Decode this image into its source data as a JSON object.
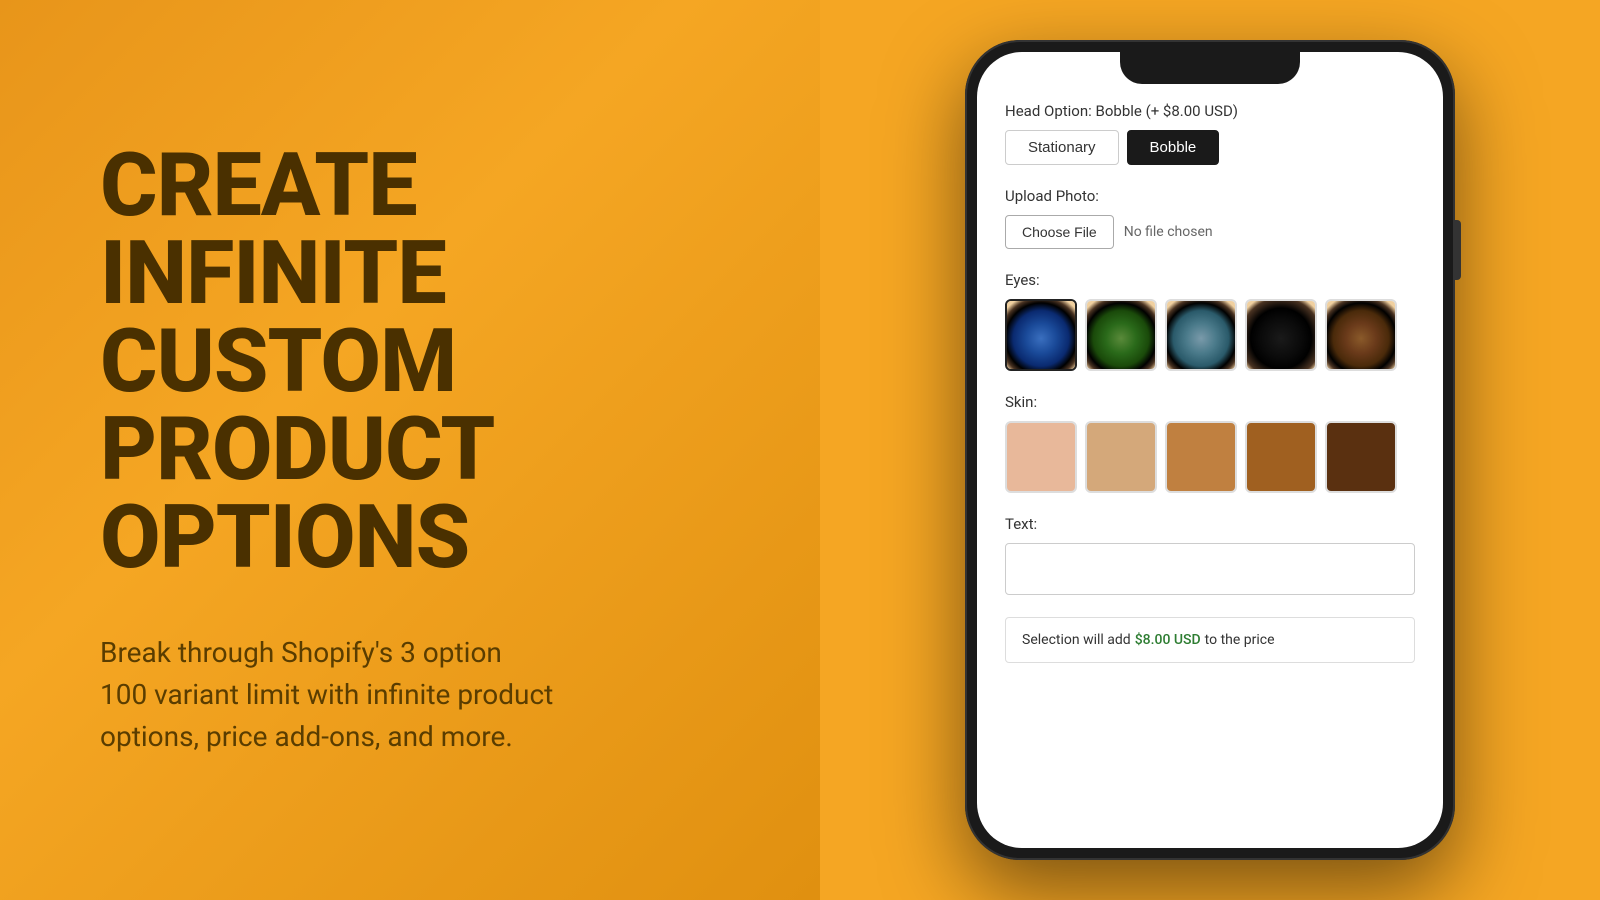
{
  "left": {
    "headline_line1": "CREATE",
    "headline_line2": "INFINITE CUSTOM",
    "headline_line3": "PRODUCT OPTIONS",
    "subtext": "Break through Shopify's 3 option\n100 variant limit with infinite product\noptions, price add-ons, and more."
  },
  "phone": {
    "head_option": {
      "label_key": "Head Option:",
      "label_value": "Bobble  (+ $8.00 USD)",
      "btn_stationary": "Stationary",
      "btn_bobble": "Bobble"
    },
    "upload": {
      "label": "Upload Photo:",
      "btn_choose": "Choose File",
      "no_file": "No file chosen"
    },
    "eyes": {
      "label": "Eyes:",
      "swatches": [
        {
          "id": "eye-blue",
          "class": "eye-canvas-1"
        },
        {
          "id": "eye-green",
          "class": "eye-canvas-2"
        },
        {
          "id": "eye-grey",
          "class": "eye-canvas-3"
        },
        {
          "id": "eye-dark",
          "class": "eye-canvas-4"
        },
        {
          "id": "eye-brown",
          "class": "eye-canvas-5"
        }
      ]
    },
    "skin": {
      "label": "Skin:",
      "swatches": [
        {
          "id": "skin-1",
          "class": "skin-1"
        },
        {
          "id": "skin-2",
          "class": "skin-2"
        },
        {
          "id": "skin-3",
          "class": "skin-3"
        },
        {
          "id": "skin-4",
          "class": "skin-4"
        },
        {
          "id": "skin-5",
          "class": "skin-5"
        }
      ]
    },
    "text_option": {
      "label": "Text:",
      "placeholder": ""
    },
    "price_notice": {
      "prefix": "Selection will add ",
      "price": "$8.00 USD",
      "suffix": " to the price"
    }
  }
}
